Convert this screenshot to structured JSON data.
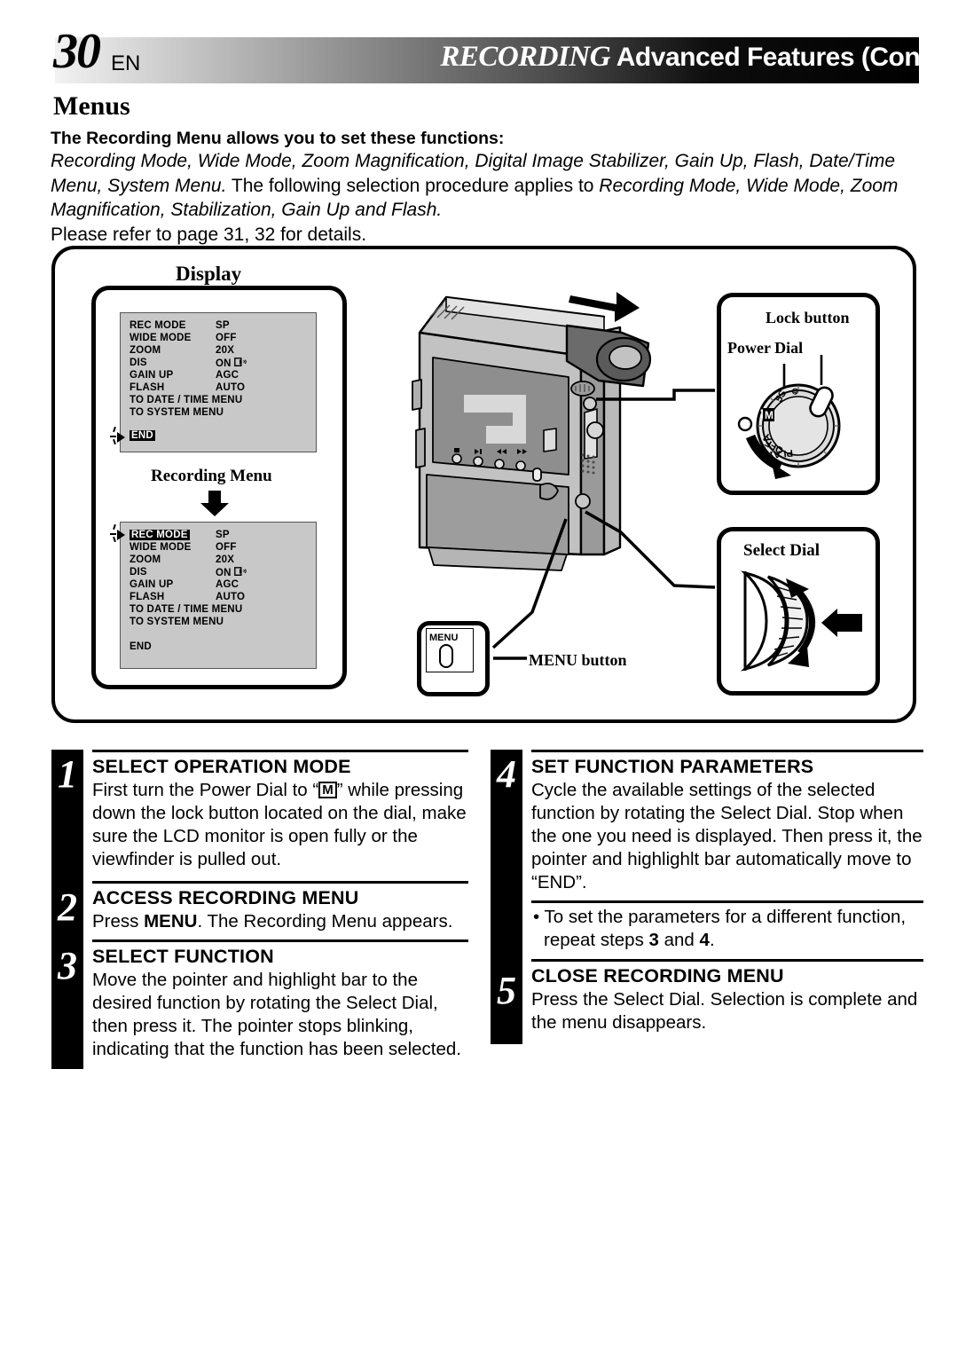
{
  "header": {
    "page_number": "30",
    "lang": "EN",
    "title_italic": "RECORDING",
    "title_rest": "Advanced Features (Cont.)"
  },
  "section_title": "Menus",
  "intro": {
    "lead": "The Recording Menu allows you to set these functions:",
    "line1_italic": "Recording Mode, Wide Mode, Zoom Magnification, Digital Image Stabilizer, Gain Up, Flash, Date/Time",
    "line2_italic_a": "Menu, System Menu.",
    "line2_plain": " The following selection procedure applies to ",
    "line2_italic_b": "Recording Mode, Wide Mode, Zoom",
    "line3_italic": "Magnification, Stabilization, Gain Up and Flash.",
    "line4": "Please refer to page 31, 32 for details."
  },
  "diagram": {
    "display_label": "Display",
    "recording_menu_caption": "Recording Menu",
    "menu_button_cap": "MENU",
    "labels": {
      "lock_button": "Lock button",
      "power_dial": "Power Dial",
      "select_dial": "Select Dial",
      "menu_button": "MENU button"
    },
    "power_dial_marks": [
      "5S",
      "M",
      "A",
      "OFF",
      "PLAY"
    ],
    "lcd_panel_1": {
      "rows": [
        {
          "label": "REC MODE",
          "value": "SP"
        },
        {
          "label": "WIDE MODE",
          "value": "OFF"
        },
        {
          "label": "ZOOM",
          "value": "20X"
        },
        {
          "label": "DIS",
          "value": "ON"
        },
        {
          "label": "GAIN UP",
          "value": "AGC"
        },
        {
          "label": "FLASH",
          "value": "AUTO"
        },
        {
          "label": "TO DATE / TIME MENU",
          "value": ""
        },
        {
          "label": "TO SYSTEM MENU",
          "value": ""
        }
      ],
      "end_label": "END",
      "highlighted": "END"
    },
    "lcd_panel_2": {
      "rows": [
        {
          "label": "REC MODE",
          "value": "SP"
        },
        {
          "label": "WIDE MODE",
          "value": "OFF"
        },
        {
          "label": "ZOOM",
          "value": "20X"
        },
        {
          "label": "DIS",
          "value": "ON"
        },
        {
          "label": "GAIN UP",
          "value": "AGC"
        },
        {
          "label": "FLASH",
          "value": "AUTO"
        },
        {
          "label": "TO DATE / TIME MENU",
          "value": ""
        },
        {
          "label": "TO SYSTEM MENU",
          "value": ""
        }
      ],
      "end_label": "END",
      "highlighted": "REC MODE"
    }
  },
  "steps": [
    {
      "num": "1",
      "heading": "SELECT OPERATION MODE",
      "body_a": "First turn the Power Dial to “",
      "body_icon": "M",
      "body_b": "” while pressing down the lock button located on the dial, make sure the LCD monitor is open fully or the viewfinder is pulled out."
    },
    {
      "num": "2",
      "heading": "ACCESS RECORDING MENU",
      "body_a": "Press ",
      "body_strong": "MENU",
      "body_b": ". The Recording Menu appears."
    },
    {
      "num": "3",
      "heading": "SELECT FUNCTION",
      "body": "Move the pointer and highlight bar to the desired function by rotating the Select Dial, then press it. The pointer stops blinking, indicating that the function has been selected."
    },
    {
      "num": "4",
      "heading": "SET FUNCTION PARAMETERS",
      "body": "Cycle the available settings of the selected function by rotating the Select Dial. Stop when the one you need is displayed. Then press it, the pointer and highlighlt bar automatically move to “END”.",
      "note_a": "• To set the parameters for a different function, repeat steps ",
      "note_b": "3",
      "note_c": " and ",
      "note_d": "4",
      "note_e": "."
    },
    {
      "num": "5",
      "heading": "CLOSE RECORDING MENU",
      "body": "Press the Select Dial. Selection is complete and the menu disappears."
    }
  ],
  "colors": {
    "lcd_bg": "#c8c8c8",
    "ink": "#000000",
    "paper": "#ffffff"
  }
}
